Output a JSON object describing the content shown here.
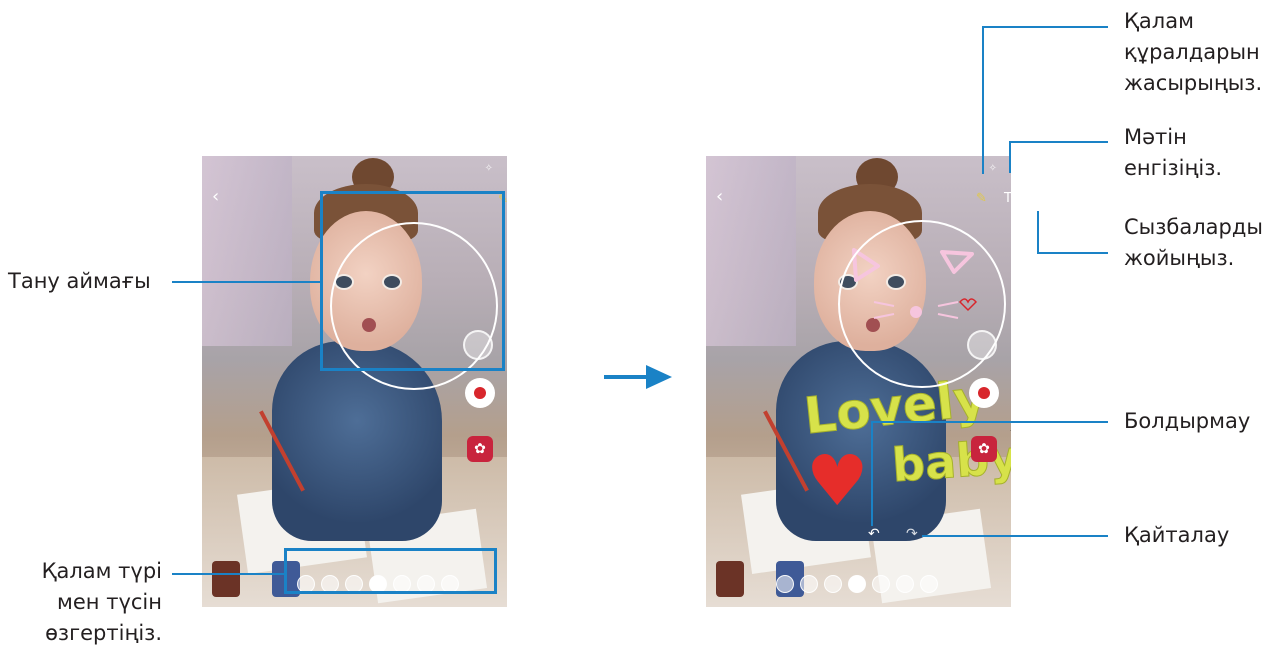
{
  "labels": {
    "recognition_area": "Тану аймағы",
    "pen_type_line1": "Қалам түрі",
    "pen_type_line2": "мен түсін",
    "pen_type_line3": "өзгертіңіз.",
    "hide_pen_line1": "Қалам",
    "hide_pen_line2": "құралдарын",
    "hide_pen_line3": "жасырыңыз.",
    "enter_text_line1": "Мәтін",
    "enter_text_line2": "енгізіңіз.",
    "delete_line1": "Сызбаларды",
    "delete_line2": "жойыңыз.",
    "undo": "Болдырмау",
    "redo": "Қайталау"
  },
  "doodle": {
    "word1": "Lovely",
    "word2": "baby"
  },
  "icons": {
    "back": "chevron-left-icon",
    "flash": "flash-icon",
    "pen": "pen-icon",
    "text": "text-icon",
    "trash": "trash-icon",
    "settings": "gear-icon",
    "switch_camera": "switch-camera-icon",
    "record": "record-icon",
    "effects": "flower-icon",
    "undo": "undo-icon",
    "redo": "redo-icon"
  },
  "colors": {
    "callout": "#1a82c6",
    "record": "#d8262c",
    "effects": "#c8243d",
    "doodle_text": "#d7e24a",
    "heart": "#e62d2a"
  }
}
